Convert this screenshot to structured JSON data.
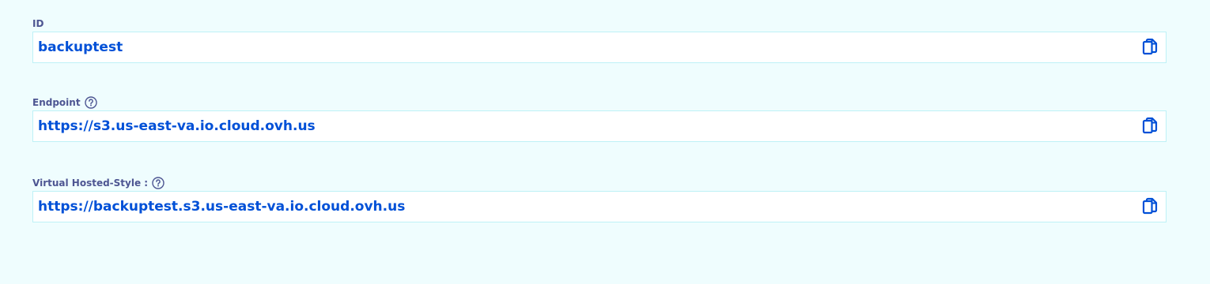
{
  "fields": [
    {
      "label": "ID",
      "value": "backuptest",
      "has_help": false,
      "copy_icon": "copy-icon"
    },
    {
      "label": "Endpoint",
      "value": "https://s3.us-east-va.io.cloud.ovh.us",
      "has_help": true,
      "help_icon": "help-circle-icon",
      "copy_icon": "copy-icon"
    },
    {
      "label": "Virtual Hosted-Style :",
      "value": "https://backuptest.s3.us-east-va.io.cloud.ovh.us",
      "has_help": true,
      "help_icon": "help-circle-icon",
      "copy_icon": "copy-icon"
    }
  ],
  "colors": {
    "background": "#effdfe",
    "label": "#4d5592",
    "value": "#0050d7",
    "border": "#bef1f6",
    "icon": "#0050d7"
  }
}
